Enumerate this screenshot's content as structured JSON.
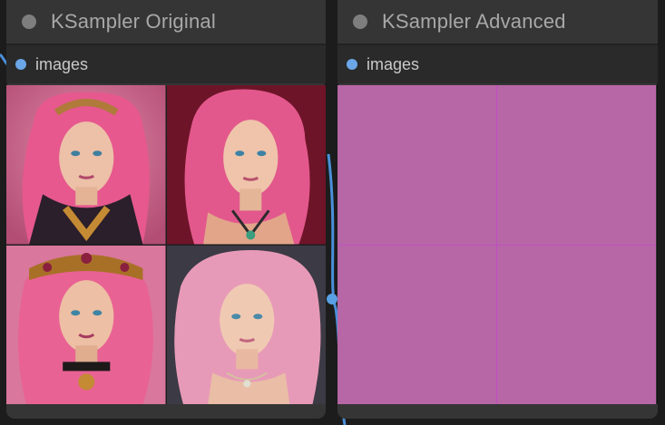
{
  "nodes": [
    {
      "title": "KSampler Original",
      "output": {
        "label": "images"
      },
      "preview": {
        "images": [
          {
            "subject": "pink-haired woman with jeweled headband and gold necklace"
          },
          {
            "subject": "pink-haired woman with pendant necklace"
          },
          {
            "subject": "pink-haired woman with gold crown"
          },
          {
            "subject": "pink-haired woman with wavy hair and necklace"
          }
        ]
      }
    },
    {
      "title": "KSampler Advanced",
      "output": {
        "label": "images"
      },
      "preview": {
        "images": [
          {
            "fill": "#b766a6"
          },
          {
            "fill": "#b766a6"
          },
          {
            "fill": "#b766a6"
          },
          {
            "fill": "#b766a6"
          }
        ]
      }
    }
  ],
  "colors": {
    "canvas": "#1c1c1c",
    "node_body": "#353535",
    "slot_dot": "#6aa6e8",
    "link": "#4a90d9",
    "broken_output": "#b766a6"
  }
}
